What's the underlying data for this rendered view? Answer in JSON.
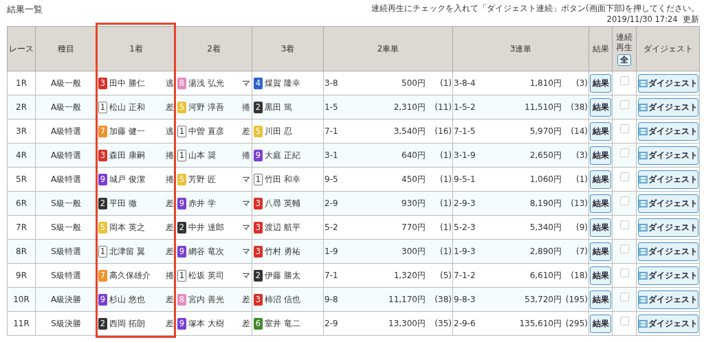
{
  "title": "結果一覧",
  "notice": "連続再生にチェックを入れて「ダイジェスト連続」ボタン(画面下部)を押してください。",
  "updated": "2019/11/30 17:24  更新",
  "columns": [
    {
      "label": "レース",
      "highlighted": false
    },
    {
      "label": "種目",
      "highlighted": false
    },
    {
      "label": "1着",
      "highlighted": true
    },
    {
      "label": "2着",
      "highlighted": false
    },
    {
      "label": "3着",
      "highlighted": false
    },
    {
      "label": "2車単",
      "highlighted": false
    },
    {
      "label": "3連単",
      "highlighted": false
    },
    {
      "label": "結果",
      "highlighted": false
    },
    {
      "label": "連続再生",
      "highlighted": false
    },
    {
      "label": "ダイジェスト",
      "highlighted": false
    }
  ],
  "select_all_button": "全",
  "rows": [
    {
      "race": "1R",
      "event": "A級一般",
      "riders": [
        {
          "num": "3",
          "color": "#d9302a",
          "name": "田中 勝仁",
          "tactic": "逃"
        },
        {
          "num": "8",
          "color": "#e58dbf",
          "name": "湯浅 弘光",
          "tactic": "マ"
        },
        {
          "num": "4",
          "color": "#2a62c9",
          "name": "煤賀 隆幸"
        }
      ],
      "exacta": {
        "combo": "3-8",
        "payout": "500円",
        "popularity": "(1)"
      },
      "trifecta": {
        "combo": "3-8-4",
        "payout": "1,810円",
        "popularity": "(3)"
      },
      "result_button": "結果",
      "checked": false,
      "digest_button": "ダイジェスト"
    },
    {
      "race": "2R",
      "event": "A級一般",
      "riders": [
        {
          "num": "1",
          "color": "#ffffff",
          "name": "松山 正和",
          "tactic": "差"
        },
        {
          "num": "5",
          "color": "#e8c23a",
          "name": "河野 淳吾",
          "tactic": "捲"
        },
        {
          "num": "2",
          "color": "#333333",
          "name": "黒田 篤"
        }
      ],
      "exacta": {
        "combo": "1-5",
        "payout": "2,310円",
        "popularity": "(11)"
      },
      "trifecta": {
        "combo": "1-5-2",
        "payout": "11,510円",
        "popularity": "(38)"
      },
      "result_button": "結果",
      "checked": false,
      "digest_button": "ダイジェスト"
    },
    {
      "race": "3R",
      "event": "A級特選",
      "riders": [
        {
          "num": "7",
          "color": "#f0922e",
          "name": "加藤 健一",
          "tactic": "逃"
        },
        {
          "num": "1",
          "color": "#ffffff",
          "name": "中曽 直彦",
          "tactic": "差"
        },
        {
          "num": "5",
          "color": "#e8c23a",
          "name": "川田 忍"
        }
      ],
      "exacta": {
        "combo": "7-1",
        "payout": "3,540円",
        "popularity": "(16)"
      },
      "trifecta": {
        "combo": "7-1-5",
        "payout": "5,970円",
        "popularity": "(14)"
      },
      "result_button": "結果",
      "checked": false,
      "digest_button": "ダイジェスト"
    },
    {
      "race": "4R",
      "event": "A級特選",
      "riders": [
        {
          "num": "3",
          "color": "#d9302a",
          "name": "森田 康嗣",
          "tactic": "捲"
        },
        {
          "num": "1",
          "color": "#ffffff",
          "name": "山本 奨",
          "tactic": "捲"
        },
        {
          "num": "9",
          "color": "#7b3fd0",
          "name": "大庭 正紀"
        }
      ],
      "exacta": {
        "combo": "3-1",
        "payout": "640円",
        "popularity": "(1)"
      },
      "trifecta": {
        "combo": "3-1-9",
        "payout": "2,650円",
        "popularity": "(3)"
      },
      "result_button": "結果",
      "checked": false,
      "digest_button": "ダイジェスト"
    },
    {
      "race": "5R",
      "event": "A級特選",
      "riders": [
        {
          "num": "9",
          "color": "#7b3fd0",
          "name": "城戸 俊潔",
          "tactic": "捲"
        },
        {
          "num": "5",
          "color": "#e8c23a",
          "name": "芳野 匠",
          "tactic": "マ"
        },
        {
          "num": "1",
          "color": "#ffffff",
          "name": "竹田 和幸"
        }
      ],
      "exacta": {
        "combo": "9-5",
        "payout": "450円",
        "popularity": "(1)"
      },
      "trifecta": {
        "combo": "9-5-1",
        "payout": "1,060円",
        "popularity": "(1)"
      },
      "result_button": "結果",
      "checked": false,
      "digest_button": "ダイジェスト"
    },
    {
      "race": "6R",
      "event": "S級一般",
      "riders": [
        {
          "num": "2",
          "color": "#333333",
          "name": "平田 徹",
          "tactic": "差"
        },
        {
          "num": "9",
          "color": "#7b3fd0",
          "name": "赤井 学",
          "tactic": "マ"
        },
        {
          "num": "3",
          "color": "#d9302a",
          "name": "八尋 英輔"
        }
      ],
      "exacta": {
        "combo": "2-9",
        "payout": "930円",
        "popularity": "(1)"
      },
      "trifecta": {
        "combo": "2-9-3",
        "payout": "8,190円",
        "popularity": "(13)"
      },
      "result_button": "結果",
      "checked": false,
      "digest_button": "ダイジェスト"
    },
    {
      "race": "7R",
      "event": "S級一般",
      "riders": [
        {
          "num": "5",
          "color": "#e8c23a",
          "name": "岡本 英之",
          "tactic": "差"
        },
        {
          "num": "2",
          "color": "#333333",
          "name": "中井 達郎",
          "tactic": "マ"
        },
        {
          "num": "3",
          "color": "#d9302a",
          "name": "渡辺 航平"
        }
      ],
      "exacta": {
        "combo": "5-2",
        "payout": "770円",
        "popularity": "(1)"
      },
      "trifecta": {
        "combo": "5-2-3",
        "payout": "5,340円",
        "popularity": "(9)"
      },
      "result_button": "結果",
      "checked": false,
      "digest_button": "ダイジェスト"
    },
    {
      "race": "8R",
      "event": "S級特選",
      "riders": [
        {
          "num": "1",
          "color": "#ffffff",
          "name": "北津留 翼",
          "tactic": "差"
        },
        {
          "num": "9",
          "color": "#7b3fd0",
          "name": "網谷 竜次",
          "tactic": "マ"
        },
        {
          "num": "3",
          "color": "#d9302a",
          "name": "竹村 勇祐"
        }
      ],
      "exacta": {
        "combo": "1-9",
        "payout": "300円",
        "popularity": "(1)"
      },
      "trifecta": {
        "combo": "1-9-3",
        "payout": "2,890円",
        "popularity": "(7)"
      },
      "result_button": "結果",
      "checked": false,
      "digest_button": "ダイジェスト"
    },
    {
      "race": "9R",
      "event": "S級特選",
      "riders": [
        {
          "num": "7",
          "color": "#f0922e",
          "name": "高久保雄介",
          "tactic": "捲"
        },
        {
          "num": "1",
          "color": "#ffffff",
          "name": "松坂 英司",
          "tactic": "マ"
        },
        {
          "num": "2",
          "color": "#333333",
          "name": "伊藤 勝太"
        }
      ],
      "exacta": {
        "combo": "7-1",
        "payout": "1,320円",
        "popularity": "(5)"
      },
      "trifecta": {
        "combo": "7-1-2",
        "payout": "6,610円",
        "popularity": "(18)"
      },
      "result_button": "結果",
      "checked": false,
      "digest_button": "ダイジェスト"
    },
    {
      "race": "10R",
      "event": "A級決勝",
      "riders": [
        {
          "num": "9",
          "color": "#7b3fd0",
          "name": "杉山 悠也",
          "tactic": "差"
        },
        {
          "num": "8",
          "color": "#e58dbf",
          "name": "宮内 善光",
          "tactic": "差"
        },
        {
          "num": "3",
          "color": "#d9302a",
          "name": "柿沼 信也"
        }
      ],
      "exacta": {
        "combo": "9-8",
        "payout": "11,170円",
        "popularity": "(38)"
      },
      "trifecta": {
        "combo": "9-8-3",
        "payout": "53,720円",
        "popularity": "(195)"
      },
      "result_button": "結果",
      "checked": false,
      "digest_button": "ダイジェスト"
    },
    {
      "race": "11R",
      "event": "S級決勝",
      "riders": [
        {
          "num": "2",
          "color": "#333333",
          "name": "西岡 拓朗",
          "tactic": "差"
        },
        {
          "num": "9",
          "color": "#7b3fd0",
          "name": "塚本 大樹",
          "tactic": "差"
        },
        {
          "num": "6",
          "color": "#3d8a2a",
          "name": "室井 竜二"
        }
      ],
      "exacta": {
        "combo": "2-9",
        "payout": "13,300円",
        "popularity": "(35)"
      },
      "trifecta": {
        "combo": "2-9-6",
        "payout": "135,610円",
        "popularity": "(295)"
      },
      "result_button": "結果",
      "checked": false,
      "digest_button": "ダイジェスト"
    }
  ]
}
